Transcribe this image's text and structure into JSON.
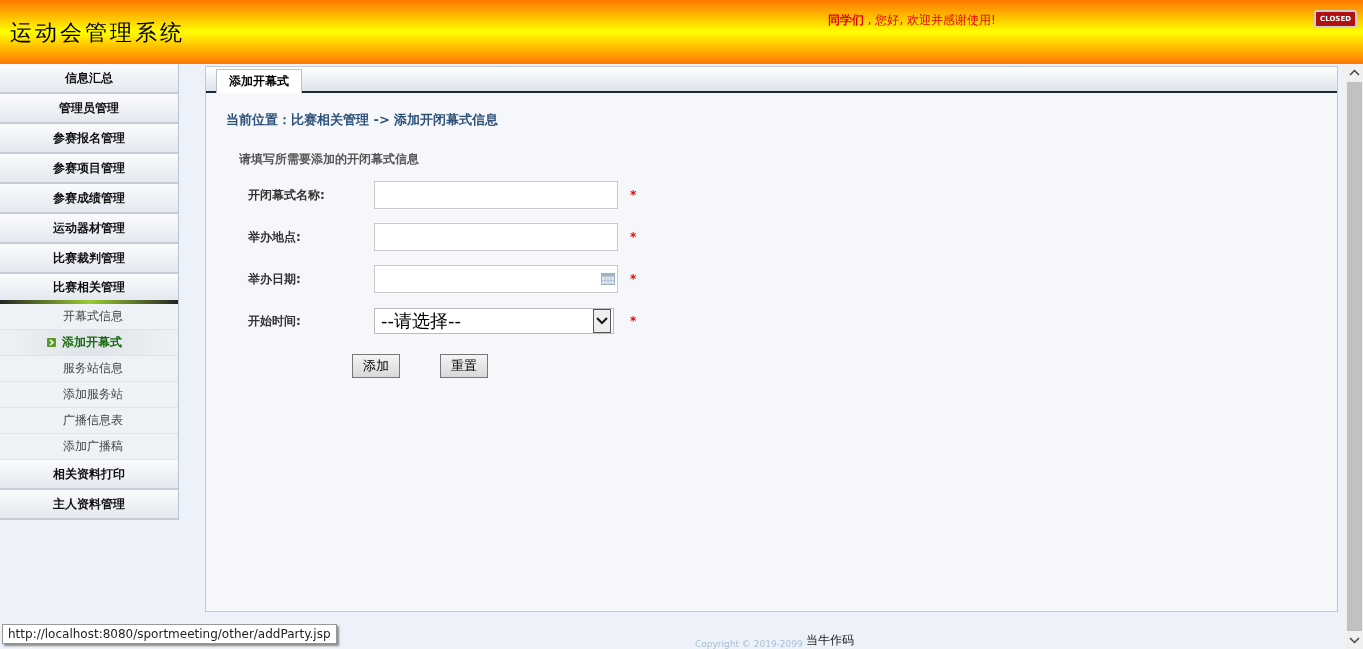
{
  "header": {
    "title": "运动会管理系统",
    "welcome": "**同学们** , 您好, 欢迎并感谢使用!",
    "close_button": "CLOSED"
  },
  "sidebar": {
    "items": [
      {
        "label": "信息汇总",
        "expanded": false
      },
      {
        "label": "管理员管理",
        "expanded": false
      },
      {
        "label": "参赛报名管理",
        "expanded": false
      },
      {
        "label": "参赛项目管理",
        "expanded": false
      },
      {
        "label": "参赛成绩管理",
        "expanded": false
      },
      {
        "label": "运动器材管理",
        "expanded": false
      },
      {
        "label": "比赛裁判管理",
        "expanded": false
      },
      {
        "label": "比赛相关管理",
        "expanded": true,
        "children": [
          {
            "label": "开幕式信息",
            "selected": false
          },
          {
            "label": "添加开幕式",
            "selected": true
          },
          {
            "label": "服务站信息",
            "selected": false
          },
          {
            "label": "添加服务站",
            "selected": false
          },
          {
            "label": "广播信息表",
            "selected": false
          },
          {
            "label": "添加广播稿",
            "selected": false
          }
        ]
      },
      {
        "label": "相关资料打印",
        "expanded": false
      },
      {
        "label": "主人资料管理",
        "expanded": false
      }
    ]
  },
  "tabs": [
    {
      "label": "添加开幕式",
      "selected": true
    }
  ],
  "breadcrumb": "当前位置：比赛相关管理 -> 添加开闭幕式信息",
  "form": {
    "heading": "请填写所需要添加的开闭幕式信息",
    "fields": [
      {
        "kind": "text",
        "label": "开闭幕式名称:",
        "required": "*"
      },
      {
        "kind": "text",
        "label": "举办地点:",
        "required": "*"
      },
      {
        "kind": "date",
        "label": "举办日期:",
        "required": "*"
      },
      {
        "kind": "select",
        "label": "开始时间:",
        "value": "--请选择--",
        "required": "*"
      }
    ],
    "buttons": [
      "添加",
      "重置"
    ]
  },
  "status_url": "http://localhost:8080/sportmeeting/other/addParty.jsp",
  "footer": {
    "copyright": "Copyright © 2019-2099",
    "author": "当牛作码"
  }
}
